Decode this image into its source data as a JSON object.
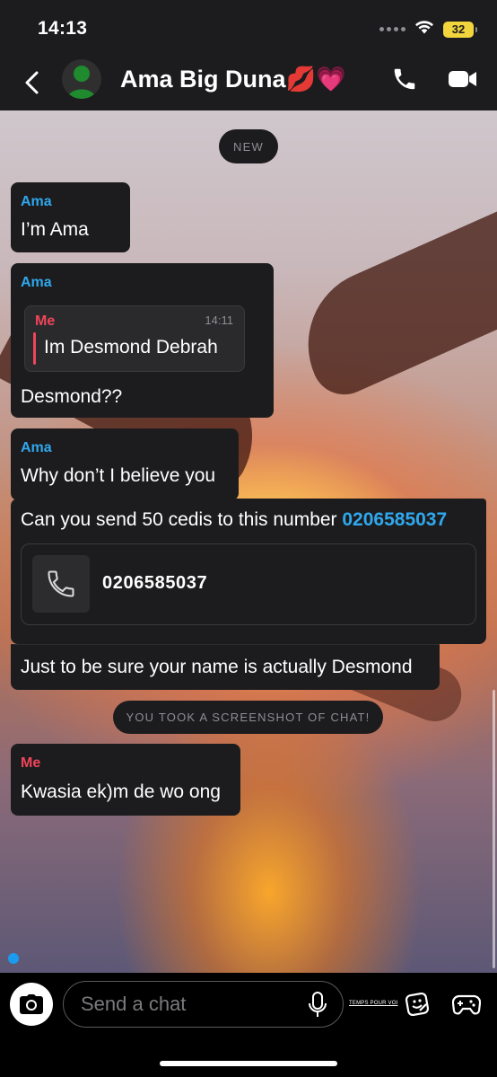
{
  "status_bar": {
    "time": "14:13",
    "battery": "32",
    "battery_color": "#f2d53c"
  },
  "header": {
    "contact_name": "Ama Big Duna💋💗",
    "icons": [
      "back-chevron-icon",
      "bitmoji-avatar",
      "phone-icon",
      "video-camera-icon"
    ]
  },
  "chat": {
    "new_label": "NEW",
    "screenshot_notice": "YOU TOOK A SCREENSHOT OF CHAT!",
    "colors": {
      "ama": "#2fa8ee",
      "me": "#f0455a",
      "bubble_bg": "#1c1c1e",
      "link": "#2fa8ee"
    },
    "messages": [
      {
        "sender": "Ama",
        "text": "I’m Ama"
      },
      {
        "sender": "Ama",
        "quote": {
          "sender": "Me",
          "time": "14:11",
          "text": "Im Desmond Debrah"
        },
        "text": "Desmond??"
      },
      {
        "sender": "Ama",
        "text": "Why don’t I believe you"
      },
      {
        "text": "Can you send 50 cedis to this number ",
        "link": "0206585037"
      },
      {
        "card_number": "0206585037",
        "card_icon": "phone-icon"
      },
      {
        "text": "Just to be sure your name is actually Desmond"
      },
      {
        "sender": "Me",
        "text": "Kwasia ek)m de wo ong"
      }
    ]
  },
  "bottom_bar": {
    "input_placeholder": "Send a chat",
    "temps_text": "TEMPS POUR VOI",
    "icons": [
      "camera-icon",
      "microphone-icon",
      "sticker-icon",
      "game-controller-icon"
    ]
  }
}
